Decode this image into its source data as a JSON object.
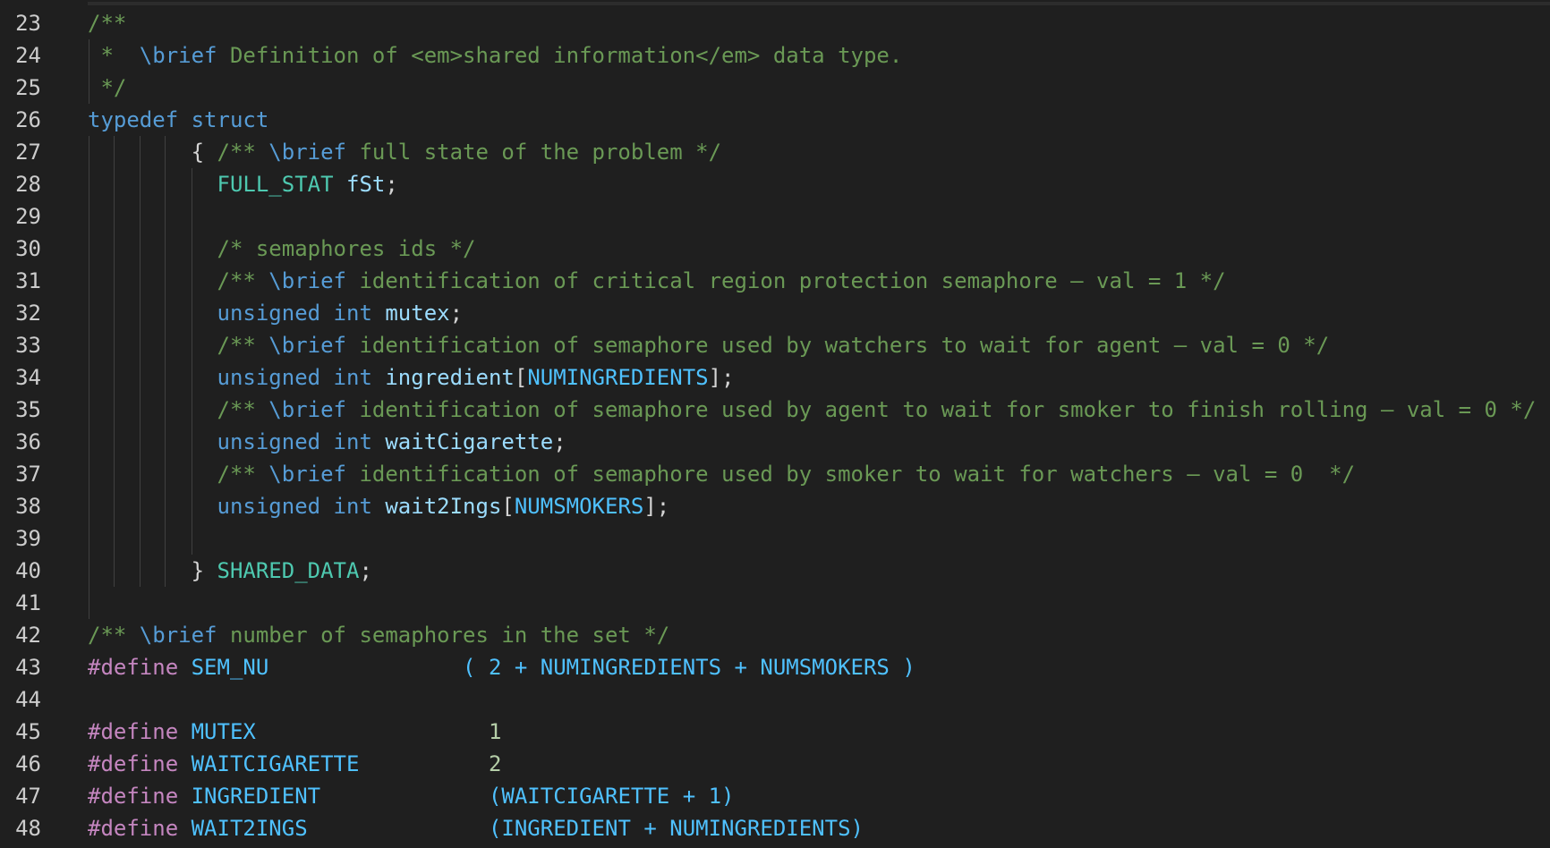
{
  "colors": {
    "background": "#1f1f1f",
    "line_number": "#cccccc",
    "comment": "#6a9955",
    "keyword": "#569cd6",
    "type": "#4ec9b0",
    "variable": "#9cdcfe",
    "macro": "#4fc1ff",
    "preprocessor": "#c586c0",
    "number": "#b5cea8",
    "indent_guide": "#404040"
  },
  "lines": [
    {
      "n": "23",
      "tokens": [
        {
          "t": "/**",
          "c": "comment"
        }
      ]
    },
    {
      "n": "24",
      "tokens": [
        {
          "t": " *  ",
          "c": "comment"
        },
        {
          "t": "\\brief",
          "c": "doc"
        },
        {
          "t": " Definition of <em>shared information</em> data type.",
          "c": "comment"
        }
      ]
    },
    {
      "n": "25",
      "tokens": [
        {
          "t": " */",
          "c": "comment"
        }
      ]
    },
    {
      "n": "26",
      "tokens": [
        {
          "t": "typedef",
          "c": "keyword"
        },
        {
          "t": " ",
          "c": "punc"
        },
        {
          "t": "struct",
          "c": "keyword"
        }
      ]
    },
    {
      "n": "27",
      "tokens": [
        {
          "t": "        { ",
          "c": "punc"
        },
        {
          "t": "/** ",
          "c": "comment"
        },
        {
          "t": "\\brief",
          "c": "doc"
        },
        {
          "t": " full state of the problem */",
          "c": "comment"
        }
      ]
    },
    {
      "n": "28",
      "tokens": [
        {
          "t": "          ",
          "c": "punc"
        },
        {
          "t": "FULL_STAT",
          "c": "type"
        },
        {
          "t": " ",
          "c": "punc"
        },
        {
          "t": "fSt",
          "c": "var"
        },
        {
          "t": ";",
          "c": "punc"
        }
      ]
    },
    {
      "n": "29",
      "tokens": []
    },
    {
      "n": "30",
      "tokens": [
        {
          "t": "          ",
          "c": "punc"
        },
        {
          "t": "/* semaphores ids */",
          "c": "comment"
        }
      ]
    },
    {
      "n": "31",
      "tokens": [
        {
          "t": "          ",
          "c": "punc"
        },
        {
          "t": "/** ",
          "c": "comment"
        },
        {
          "t": "\\brief",
          "c": "doc"
        },
        {
          "t": " identification of critical region protection semaphore – val = 1 */",
          "c": "comment"
        }
      ]
    },
    {
      "n": "32",
      "tokens": [
        {
          "t": "          ",
          "c": "punc"
        },
        {
          "t": "unsigned",
          "c": "keyword"
        },
        {
          "t": " ",
          "c": "punc"
        },
        {
          "t": "int",
          "c": "keyword"
        },
        {
          "t": " ",
          "c": "punc"
        },
        {
          "t": "mutex",
          "c": "var"
        },
        {
          "t": ";",
          "c": "punc"
        }
      ]
    },
    {
      "n": "33",
      "tokens": [
        {
          "t": "          ",
          "c": "punc"
        },
        {
          "t": "/** ",
          "c": "comment"
        },
        {
          "t": "\\brief",
          "c": "doc"
        },
        {
          "t": " identification of semaphore used by watchers to wait for agent – val = 0 */",
          "c": "comment"
        }
      ]
    },
    {
      "n": "34",
      "tokens": [
        {
          "t": "          ",
          "c": "punc"
        },
        {
          "t": "unsigned",
          "c": "keyword"
        },
        {
          "t": " ",
          "c": "punc"
        },
        {
          "t": "int",
          "c": "keyword"
        },
        {
          "t": " ",
          "c": "punc"
        },
        {
          "t": "ingredient",
          "c": "var"
        },
        {
          "t": "[",
          "c": "punc"
        },
        {
          "t": "NUMINGREDIENTS",
          "c": "macro"
        },
        {
          "t": "];",
          "c": "punc"
        }
      ]
    },
    {
      "n": "35",
      "tokens": [
        {
          "t": "          ",
          "c": "punc"
        },
        {
          "t": "/** ",
          "c": "comment"
        },
        {
          "t": "\\brief",
          "c": "doc"
        },
        {
          "t": " identification of semaphore used by agent to wait for smoker to finish rolling – val = 0 */",
          "c": "comment"
        }
      ]
    },
    {
      "n": "36",
      "tokens": [
        {
          "t": "          ",
          "c": "punc"
        },
        {
          "t": "unsigned",
          "c": "keyword"
        },
        {
          "t": " ",
          "c": "punc"
        },
        {
          "t": "int",
          "c": "keyword"
        },
        {
          "t": " ",
          "c": "punc"
        },
        {
          "t": "waitCigarette",
          "c": "var"
        },
        {
          "t": ";",
          "c": "punc"
        }
      ]
    },
    {
      "n": "37",
      "tokens": [
        {
          "t": "          ",
          "c": "punc"
        },
        {
          "t": "/** ",
          "c": "comment"
        },
        {
          "t": "\\brief",
          "c": "doc"
        },
        {
          "t": " identification of semaphore used by smoker to wait for watchers – val = 0  */",
          "c": "comment"
        }
      ]
    },
    {
      "n": "38",
      "tokens": [
        {
          "t": "          ",
          "c": "punc"
        },
        {
          "t": "unsigned",
          "c": "keyword"
        },
        {
          "t": " ",
          "c": "punc"
        },
        {
          "t": "int",
          "c": "keyword"
        },
        {
          "t": " ",
          "c": "punc"
        },
        {
          "t": "wait2Ings",
          "c": "var"
        },
        {
          "t": "[",
          "c": "punc"
        },
        {
          "t": "NUMSMOKERS",
          "c": "macro"
        },
        {
          "t": "];",
          "c": "punc"
        }
      ]
    },
    {
      "n": "39",
      "tokens": []
    },
    {
      "n": "40",
      "tokens": [
        {
          "t": "        } ",
          "c": "punc"
        },
        {
          "t": "SHARED_DATA",
          "c": "type"
        },
        {
          "t": ";",
          "c": "punc"
        }
      ]
    },
    {
      "n": "41",
      "tokens": []
    },
    {
      "n": "42",
      "tokens": [
        {
          "t": "/** ",
          "c": "comment"
        },
        {
          "t": "\\brief",
          "c": "doc"
        },
        {
          "t": " number of semaphores in the set */",
          "c": "comment"
        }
      ]
    },
    {
      "n": "43",
      "tokens": [
        {
          "t": "#define",
          "c": "define"
        },
        {
          "t": " ",
          "c": "punc"
        },
        {
          "t": "SEM_NU",
          "c": "macro"
        },
        {
          "t": "               ( 2 + NUMINGREDIENTS + NUMSMOKERS )",
          "c": "macro"
        }
      ]
    },
    {
      "n": "44",
      "tokens": []
    },
    {
      "n": "45",
      "tokens": [
        {
          "t": "#define",
          "c": "define"
        },
        {
          "t": " ",
          "c": "punc"
        },
        {
          "t": "MUTEX",
          "c": "macro"
        },
        {
          "t": "                  ",
          "c": "punc"
        },
        {
          "t": "1",
          "c": "number"
        }
      ]
    },
    {
      "n": "46",
      "tokens": [
        {
          "t": "#define",
          "c": "define"
        },
        {
          "t": " ",
          "c": "punc"
        },
        {
          "t": "WAITCIGARETTE",
          "c": "macro"
        },
        {
          "t": "          ",
          "c": "punc"
        },
        {
          "t": "2",
          "c": "number"
        }
      ]
    },
    {
      "n": "47",
      "tokens": [
        {
          "t": "#define",
          "c": "define"
        },
        {
          "t": " ",
          "c": "punc"
        },
        {
          "t": "INGREDIENT",
          "c": "macro"
        },
        {
          "t": "             ",
          "c": "punc"
        },
        {
          "t": "(WAITCIGARETTE + 1)",
          "c": "macro"
        }
      ]
    },
    {
      "n": "48",
      "tokens": [
        {
          "t": "#define",
          "c": "define"
        },
        {
          "t": " ",
          "c": "punc"
        },
        {
          "t": "WAIT2INGS",
          "c": "macro"
        },
        {
          "t": "              ",
          "c": "punc"
        },
        {
          "t": "(INGREDIENT + NUMINGREDIENTS)",
          "c": "macro"
        }
      ]
    }
  ]
}
